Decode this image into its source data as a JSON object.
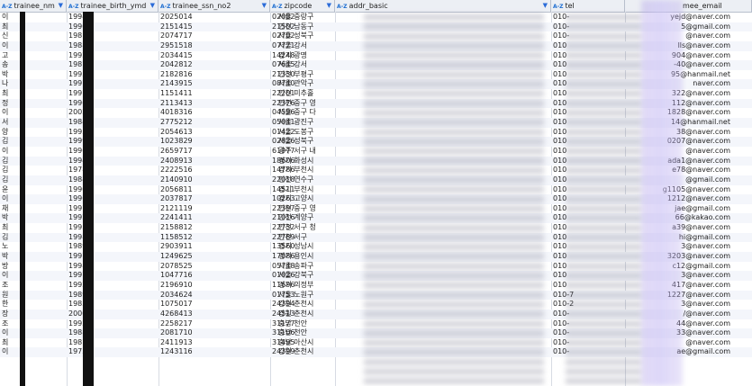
{
  "columns": [
    {
      "label": "trainee_nm",
      "az": "A-Z"
    },
    {
      "label": "trainee_birth_ymd",
      "az": "A-Z"
    },
    {
      "label": "trainee_ssn_no2",
      "az": "A-Z"
    },
    {
      "label": "zipcode",
      "az": "A-Z"
    },
    {
      "label": "addr_basic",
      "az": "A-Z"
    },
    {
      "label": "tel",
      "az": "A-Z"
    },
    {
      "label": "mee_email",
      "az": ""
    }
  ],
  "rows": [
    {
      "name": "이",
      "birth": "1994",
      "ssn": "2025014",
      "zip": "02082",
      "addr": "서울 중랑구",
      "tel": "010-",
      "email": "yejd@naver.com"
    },
    {
      "name": "최",
      "birth": "1990",
      "ssn": "2151415",
      "zip": "21502",
      "addr": "인천 남동구",
      "tel": "010-",
      "email": "5@gmail.com"
    },
    {
      "name": "신",
      "birth": "1981",
      "ssn": "2074717",
      "zip": "02702",
      "addr": "서울 성북구",
      "tel": "010-",
      "email": "@naver.com"
    },
    {
      "name": "이",
      "birth": "1988",
      "ssn": "2951518",
      "zip": "07771",
      "addr": "서울 강서",
      "tel": "010",
      "email": "lls@naver.com"
    },
    {
      "name": "고",
      "birth": "1992",
      "ssn": "2034415",
      "zip": "14248",
      "addr": "경기 광명",
      "tel": "010",
      "email": "904@naver.com"
    },
    {
      "name": "송",
      "birth": "1987",
      "ssn": "2042812",
      "zip": "07645",
      "addr": "서울 강서",
      "tel": "010",
      "email": "-40@naver.com"
    },
    {
      "name": "박",
      "birth": "1995",
      "ssn": "2182816",
      "zip": "21330",
      "addr": "인천 부평구",
      "tel": "010",
      "email": "95@hanmail.net"
    },
    {
      "name": "나",
      "birth": "1997",
      "ssn": "2143915",
      "zip": "08740",
      "addr": "서울 관악구",
      "tel": "010",
      "email": "naver.com"
    },
    {
      "name": "최",
      "birth": "1997",
      "ssn": "1151411",
      "zip": "22201",
      "addr": "인천 미추홀",
      "tel": "010",
      "email": "322@naver.com"
    },
    {
      "name": "정",
      "birth": "1996",
      "ssn": "2113413",
      "zip": "22376",
      "addr": "인천 중구 영",
      "tel": "010",
      "email": "112@naver.com"
    },
    {
      "name": "이",
      "birth": "2002",
      "ssn": "4018316",
      "zip": "04596",
      "addr": "서울 중구 다",
      "tel": "010",
      "email": "1828@naver.com"
    },
    {
      "name": "서",
      "birth": "1984",
      "ssn": "2775212",
      "zip": "05041",
      "addr": "서울 광진구",
      "tel": "010",
      "email": "14@hanmail.net"
    },
    {
      "name": "양",
      "birth": "1995",
      "ssn": "2054613",
      "zip": "01422",
      "addr": "서울 도봉구",
      "tel": "010",
      "email": "38@naver.com"
    },
    {
      "name": "김",
      "birth": "1999",
      "ssn": "1023829",
      "zip": "02826",
      "addr": "서울 성북구",
      "tel": "010",
      "email": "0207@naver.com"
    },
    {
      "name": "이",
      "birth": "1996",
      "ssn": "2659717",
      "zip": "61977",
      "addr": "광주 서구 내",
      "tel": "010",
      "email": "@naver.com"
    },
    {
      "name": "김",
      "birth": "1994",
      "ssn": "2408913",
      "zip": "18606",
      "addr": "경기 화성시",
      "tel": "010",
      "email": "ada1@naver.com"
    },
    {
      "name": "김",
      "birth": "1978",
      "ssn": "2222516",
      "zip": "14786",
      "addr": "경기 부천시",
      "tel": "010",
      "email": "e78@naver.com"
    },
    {
      "name": "김",
      "birth": "1984",
      "ssn": "2140910",
      "zip": "22018",
      "addr": "인천 연수구",
      "tel": "010",
      "email": "@gmail.com"
    },
    {
      "name": "윤",
      "birth": "1990",
      "ssn": "2056811",
      "zip": "14511",
      "addr": "경기 부천시",
      "tel": "010",
      "email": "g1105@naver.com"
    },
    {
      "name": "이",
      "birth": "1996",
      "ssn": "2037817",
      "zip": "10263",
      "addr": "경기 고양시",
      "tel": "010",
      "email": "1212@naver.com"
    },
    {
      "name": "채",
      "birth": "1997",
      "ssn": "2121119",
      "zip": "22397",
      "addr": "인천 중구 영",
      "tel": "010",
      "email": "jae@gmail.com"
    },
    {
      "name": "박",
      "birth": "1992",
      "ssn": "2241411",
      "zip": "21016",
      "addr": "인천 계양구",
      "tel": "010",
      "email": "66@kakao.com"
    },
    {
      "name": "최",
      "birth": "1995",
      "ssn": "2158812",
      "zip": "22732",
      "addr": "인천 서구 청",
      "tel": "010",
      "email": "a39@naver.com"
    },
    {
      "name": "김",
      "birth": "1998",
      "ssn": "1158512",
      "zip": "22789",
      "addr": "인천 서구",
      "tel": "010",
      "email": "hi@gmail.com"
    },
    {
      "name": "노",
      "birth": "1989",
      "ssn": "2903911",
      "zip": "13560",
      "addr": "경기 성남시",
      "tel": "010",
      "email": "3@naver.com"
    },
    {
      "name": "박",
      "birth": "1997",
      "ssn": "1249625",
      "zip": "17086",
      "addr": "경기 용인시",
      "tel": "010",
      "email": "3203@naver.com"
    },
    {
      "name": "방",
      "birth": "1998",
      "ssn": "2078525",
      "zip": "05748",
      "addr": "서울 송파구",
      "tel": "010",
      "email": "c12@gmail.com"
    },
    {
      "name": "이",
      "birth": "1997",
      "ssn": "1047716",
      "zip": "01026",
      "addr": "서울 강북구",
      "tel": "010",
      "email": "3@naver.com"
    },
    {
      "name": "조",
      "birth": "1992",
      "ssn": "2196910",
      "zip": "11696",
      "addr": "경기 의정부",
      "tel": "010",
      "email": "417@naver.com"
    },
    {
      "name": "원",
      "birth": "1989",
      "ssn": "2034624",
      "zip": "01753",
      "addr": "서울 노원구",
      "tel": "010-7",
      "email": "1227@naver.com"
    },
    {
      "name": "한",
      "birth": "1983",
      "ssn": "1075017",
      "zip": "24394",
      "addr": "강원 춘천시",
      "tel": "010-2",
      "email": "3@naver.com"
    },
    {
      "name": "장",
      "birth": "2000",
      "ssn": "4268413",
      "zip": "24513",
      "addr": "강원 춘천시",
      "tel": "010-",
      "email": "/@naver.com"
    },
    {
      "name": "조",
      "birth": "1992",
      "ssn": "2258217",
      "zip": "31177",
      "addr": "충남 천안",
      "tel": "010-",
      "email": "44@naver.com"
    },
    {
      "name": "이",
      "birth": "1988",
      "ssn": "2081710",
      "zip": "31106",
      "addr": "충남 천안",
      "tel": "010-",
      "email": "33@naver.com"
    },
    {
      "name": "최",
      "birth": "1987",
      "ssn": "2411913",
      "zip": "31495",
      "addr": "충남 아산시",
      "tel": "010-",
      "email": "@naver.com"
    },
    {
      "name": "이",
      "birth": "1973",
      "ssn": "1243116",
      "zip": "24399",
      "addr": "강원 춘천시",
      "tel": "010-",
      "email": "ae@gmail.com"
    }
  ]
}
